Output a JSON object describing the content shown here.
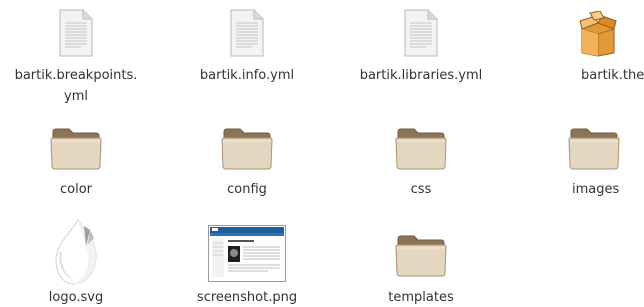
{
  "files": [
    {
      "name": "bartik.breakpoints.\nyml",
      "icon": "text-document-icon"
    },
    {
      "name": "bartik.info.yml",
      "icon": "text-document-icon"
    },
    {
      "name": "bartik.libraries.yml",
      "icon": "text-document-icon"
    },
    {
      "name": "bartik.theme",
      "icon": "package-icon"
    },
    {
      "name": "color",
      "icon": "folder-icon"
    },
    {
      "name": "config",
      "icon": "folder-icon"
    },
    {
      "name": "css",
      "icon": "folder-icon"
    },
    {
      "name": "images",
      "icon": "folder-icon"
    },
    {
      "name": "logo.svg",
      "icon": "drop-logo-icon"
    },
    {
      "name": "screenshot.png",
      "icon": "image-thumbnail-icon"
    },
    {
      "name": "templates",
      "icon": "folder-icon"
    }
  ],
  "colors": {
    "folder_body": "#d8c8ad",
    "folder_tab": "#8c7556",
    "package": "#d98c2b",
    "document": "#f2f2f2"
  }
}
